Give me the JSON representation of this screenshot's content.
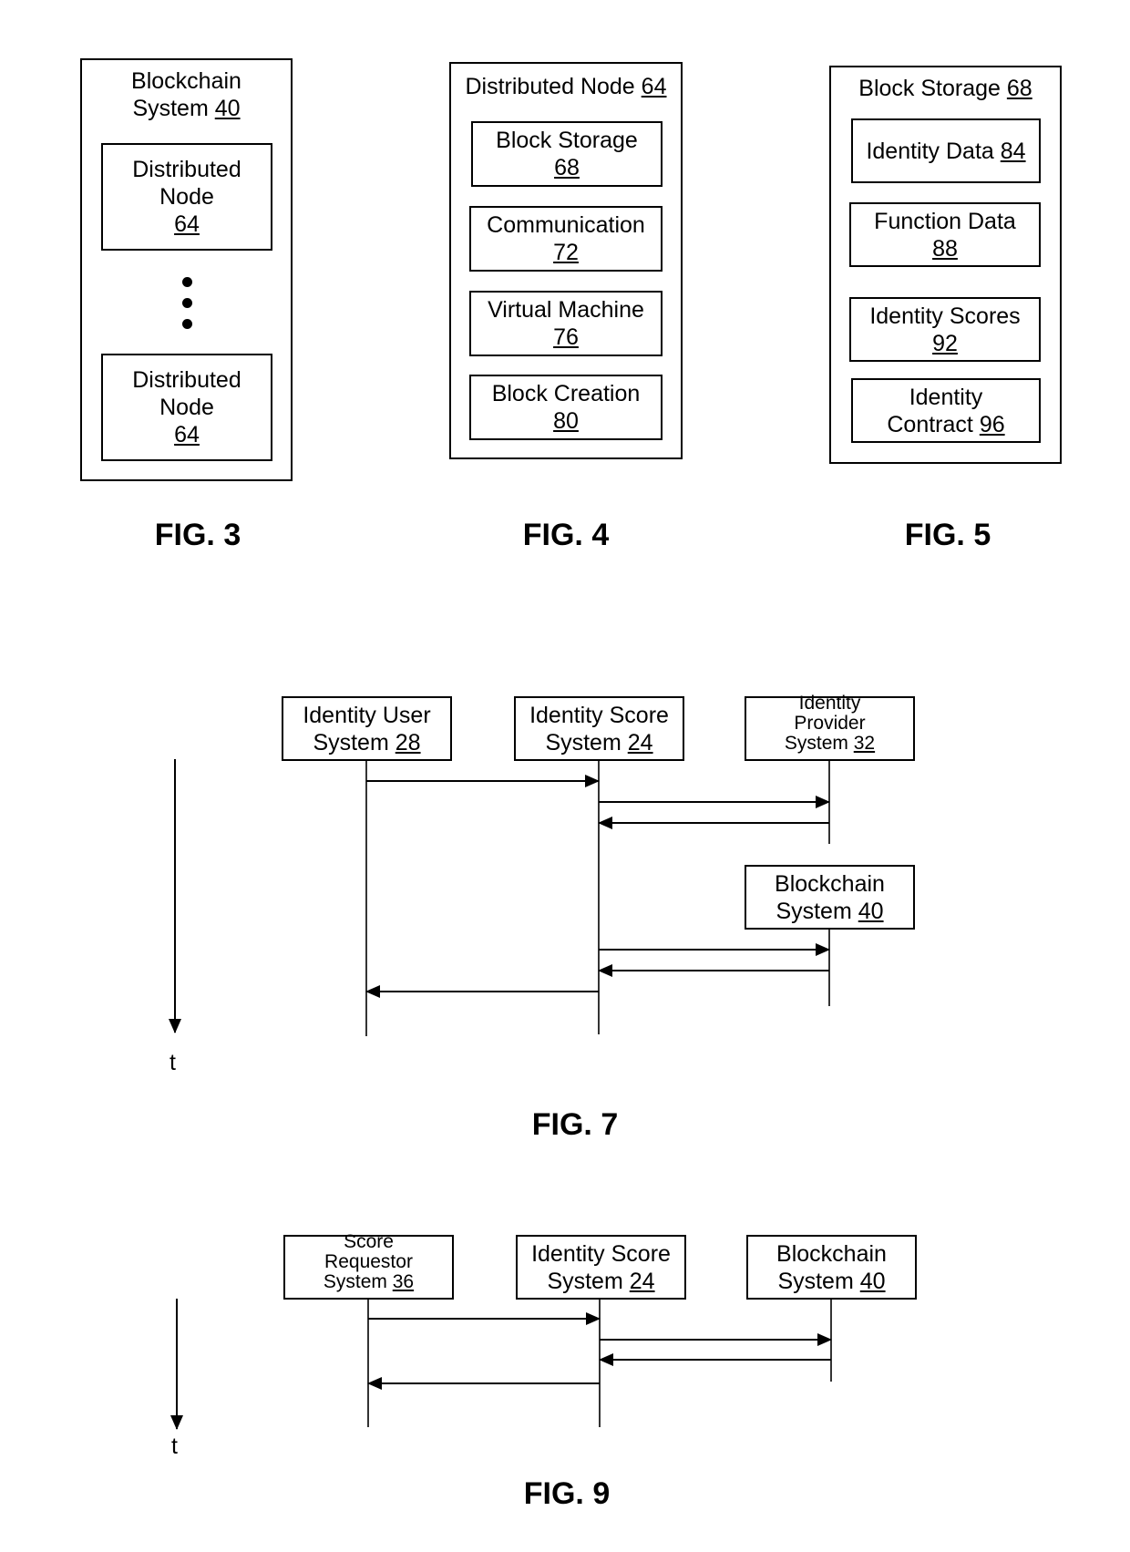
{
  "fig3": {
    "label": "FIG. 3",
    "outer": {
      "title_line1": "Blockchain",
      "title_line2": "System",
      "title_ref": "40"
    },
    "nodes": [
      {
        "line1": "Distributed",
        "line2": "Node",
        "ref": "64"
      },
      {
        "line1": "Distributed",
        "line2": "Node",
        "ref": "64"
      }
    ],
    "ellipsis_icon": "vertical-ellipsis"
  },
  "fig4": {
    "label": "FIG. 4",
    "outer": {
      "title": "Distributed Node",
      "title_ref": "64"
    },
    "components": [
      {
        "name": "Block Storage",
        "ref": "68"
      },
      {
        "name": "Communication",
        "ref": "72"
      },
      {
        "name": "Virtual Machine",
        "ref": "76"
      },
      {
        "name": "Block Creation",
        "ref": "80"
      }
    ]
  },
  "fig5": {
    "label": "FIG. 5",
    "outer": {
      "title": "Block Storage",
      "title_ref": "68"
    },
    "components": [
      {
        "line1": "Identity Data",
        "line2": "",
        "ref": "84",
        "inline_ref": true
      },
      {
        "line1": "Function Data",
        "line2": "",
        "ref": "88",
        "inline_ref": false
      },
      {
        "line1": "Identity Scores",
        "line2": "",
        "ref": "92",
        "inline_ref": false
      },
      {
        "line1": "Identity",
        "line2": "Contract",
        "ref": "96",
        "inline_ref": true
      }
    ]
  },
  "fig7": {
    "label": "FIG. 7",
    "time_label": "t",
    "actors": [
      {
        "lines": [
          "Identity User",
          "System"
        ],
        "ref": "28"
      },
      {
        "lines": [
          "Identity Score",
          "System"
        ],
        "ref": "24"
      },
      {
        "lines": [
          "Identity",
          "Provider",
          "System"
        ],
        "ref": "32"
      },
      {
        "lines": [
          "Blockchain",
          "System"
        ],
        "ref": "40"
      }
    ],
    "messages": [
      {
        "from": "Identity User System 28",
        "to": "Identity Score System 24"
      },
      {
        "from": "Identity Score System 24",
        "to": "Identity Provider System 32"
      },
      {
        "from": "Identity Provider System 32",
        "to": "Identity Score System 24"
      },
      {
        "from": "Identity Score System 24",
        "to": "Blockchain System 40"
      },
      {
        "from": "Blockchain System 40",
        "to": "Identity Score System 24"
      },
      {
        "from": "Identity Score System 24",
        "to": "Identity User System 28"
      }
    ]
  },
  "fig9": {
    "label": "FIG. 9",
    "time_label": "t",
    "actors": [
      {
        "lines": [
          "Score",
          "Requestor",
          "System"
        ],
        "ref": "36"
      },
      {
        "lines": [
          "Identity Score",
          "System"
        ],
        "ref": "24"
      },
      {
        "lines": [
          "Blockchain",
          "System"
        ],
        "ref": "40"
      }
    ],
    "messages": [
      {
        "from": "Score Requestor System 36",
        "to": "Identity Score System 24"
      },
      {
        "from": "Identity Score System 24",
        "to": "Blockchain System 40"
      },
      {
        "from": "Blockchain System 40",
        "to": "Identity Score System 24"
      },
      {
        "from": "Identity Score System 24",
        "to": "Score Requestor System 36"
      }
    ]
  }
}
